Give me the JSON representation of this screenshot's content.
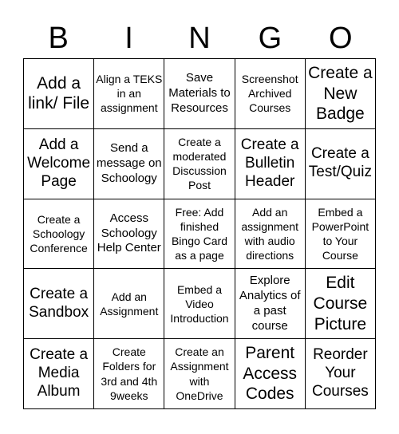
{
  "header": {
    "letters": [
      "B",
      "I",
      "N",
      "G",
      "O"
    ]
  },
  "grid": {
    "rows": [
      [
        {
          "text": "Add a link/ File",
          "size": "xl"
        },
        {
          "text": "Align a TEKS in an assignment",
          "size": "sm"
        },
        {
          "text": "Save Materials to Resources",
          "size": "md"
        },
        {
          "text": "Screenshot Archived Courses",
          "size": "sm"
        },
        {
          "text": "Create a New Badge",
          "size": "xl"
        }
      ],
      [
        {
          "text": "Add a Welcome Page",
          "size": "lg"
        },
        {
          "text": "Send a message on Schoology",
          "size": "md"
        },
        {
          "text": "Create a moderated Discussion Post",
          "size": "sm"
        },
        {
          "text": "Create a Bulletin Header",
          "size": "lg"
        },
        {
          "text": "Create a Test/Quiz",
          "size": "lg"
        }
      ],
      [
        {
          "text": "Create a Schoology Conference",
          "size": "sm"
        },
        {
          "text": "Access Schoology Help Center",
          "size": "md"
        },
        {
          "text": "Free: Add finished Bingo Card as a page",
          "size": "sm"
        },
        {
          "text": "Add an assignment with audio directions",
          "size": "sm"
        },
        {
          "text": "Embed a PowerPoint to Your Course",
          "size": "sm"
        }
      ],
      [
        {
          "text": "Create a Sandbox",
          "size": "lg"
        },
        {
          "text": "Add an Assignment",
          "size": "sm"
        },
        {
          "text": "Embed a Video Introduction",
          "size": "sm"
        },
        {
          "text": "Explore Analytics of a past course",
          "size": "md"
        },
        {
          "text": "Edit Course Picture",
          "size": "xl"
        }
      ],
      [
        {
          "text": "Create a Media Album",
          "size": "lg"
        },
        {
          "text": "Create Folders for 3rd and 4th 9weeks",
          "size": "sm"
        },
        {
          "text": "Create an Assignment with OneDrive",
          "size": "sm"
        },
        {
          "text": "Parent Access Codes",
          "size": "xl"
        },
        {
          "text": "Reorder Your Courses",
          "size": "lg"
        }
      ]
    ]
  }
}
